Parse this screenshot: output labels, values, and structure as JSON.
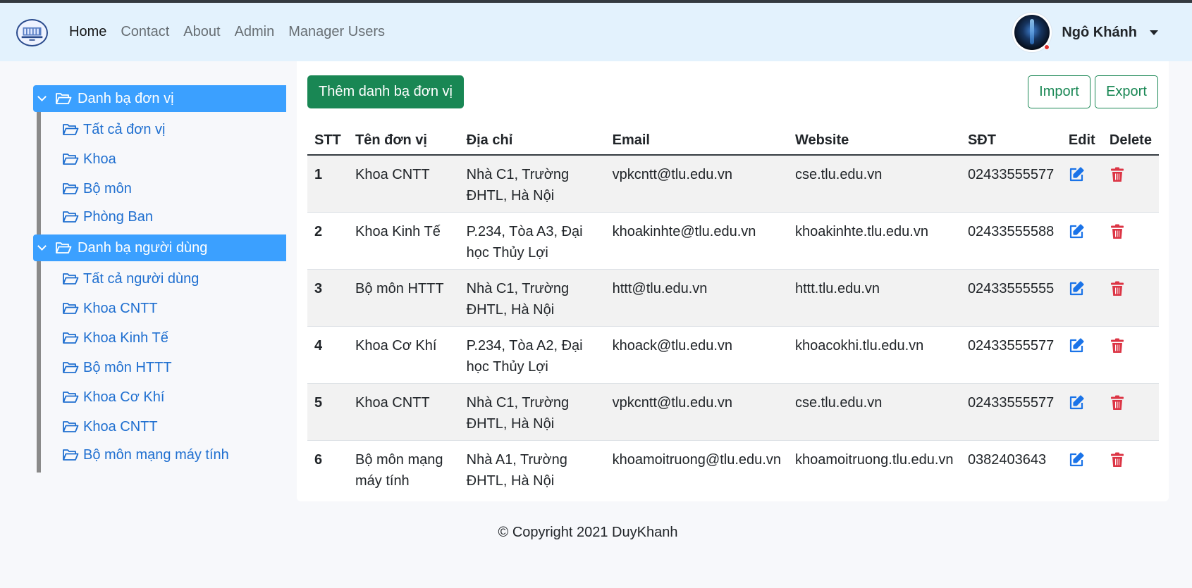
{
  "nav": {
    "links": [
      "Home",
      "Contact",
      "About",
      "Admin",
      "Manager Users"
    ],
    "user_name": "Ngô Khánh"
  },
  "sidebar": {
    "groups": [
      {
        "title": "Danh bạ đơn vị",
        "items": [
          "Tất cả đơn vị",
          "Khoa",
          "Bộ môn",
          "Phòng Ban"
        ]
      },
      {
        "title": "Danh bạ người dùng",
        "items": [
          "Tất cả người dùng",
          "Khoa CNTT",
          "Khoa Kinh Tế",
          "Bộ môn HTTT",
          "Khoa Cơ Khí",
          "Khoa CNTT",
          "Bộ môn mạng máy tính"
        ]
      }
    ]
  },
  "toolbar": {
    "add_label": "Thêm danh bạ đơn vị",
    "import_label": "Import",
    "export_label": "Export"
  },
  "table": {
    "headers": [
      "STT",
      "Tên đơn vị",
      "Địa chỉ",
      "Email",
      "Website",
      "SĐT",
      "Edit",
      "Delete"
    ],
    "rows": [
      {
        "stt": "1",
        "name": "Khoa CNTT",
        "address": "Nhà C1, Trường ĐHTL, Hà Nội",
        "email": "vpkcntt@tlu.edu.vn",
        "website": "cse.tlu.edu.vn",
        "phone": "02433555577"
      },
      {
        "stt": "2",
        "name": "Khoa Kinh Tế",
        "address": "P.234, Tòa A3, Đại học Thủy Lợi",
        "email": "khoakinhte@tlu.edu.vn",
        "website": "khoakinhte.tlu.edu.vn",
        "phone": "02433555588"
      },
      {
        "stt": "3",
        "name": "Bộ môn HTTT",
        "address": "Nhà C1, Trường ĐHTL, Hà Nội",
        "email": "httt@tlu.edu.vn",
        "website": "httt.tlu.edu.vn",
        "phone": "02433555555"
      },
      {
        "stt": "4",
        "name": "Khoa Cơ Khí",
        "address": "P.234, Tòa A2, Đại học Thủy Lợi",
        "email": "khoack@tlu.edu.vn",
        "website": "khoacokhi.tlu.edu.vn",
        "phone": "02433555577"
      },
      {
        "stt": "5",
        "name": "Khoa CNTT",
        "address": "Nhà C1, Trường ĐHTL, Hà Nội",
        "email": "vpkcntt@tlu.edu.vn",
        "website": "cse.tlu.edu.vn",
        "phone": "02433555577"
      },
      {
        "stt": "6",
        "name": "Bộ môn mạng máy tính",
        "address": "Nhà A1, Trường ĐHTL, Hà Nội",
        "email": "khoamoitruong@tlu.edu.vn",
        "website": "khoamoitruong.tlu.edu.vn",
        "phone": "0382403643"
      }
    ]
  },
  "footer": {
    "text": "© Copyright 2021 DuyKhanh"
  },
  "icons": {
    "edit": "edit-icon",
    "delete": "trash-icon",
    "folder": "folder-open-icon",
    "chevron": "chevron-down-icon"
  },
  "colors": {
    "primary": "#3ba0ff",
    "success": "#198754",
    "danger": "#dc3545",
    "link": "#1f6fd0",
    "navbar_bg": "#e3f2fd"
  }
}
